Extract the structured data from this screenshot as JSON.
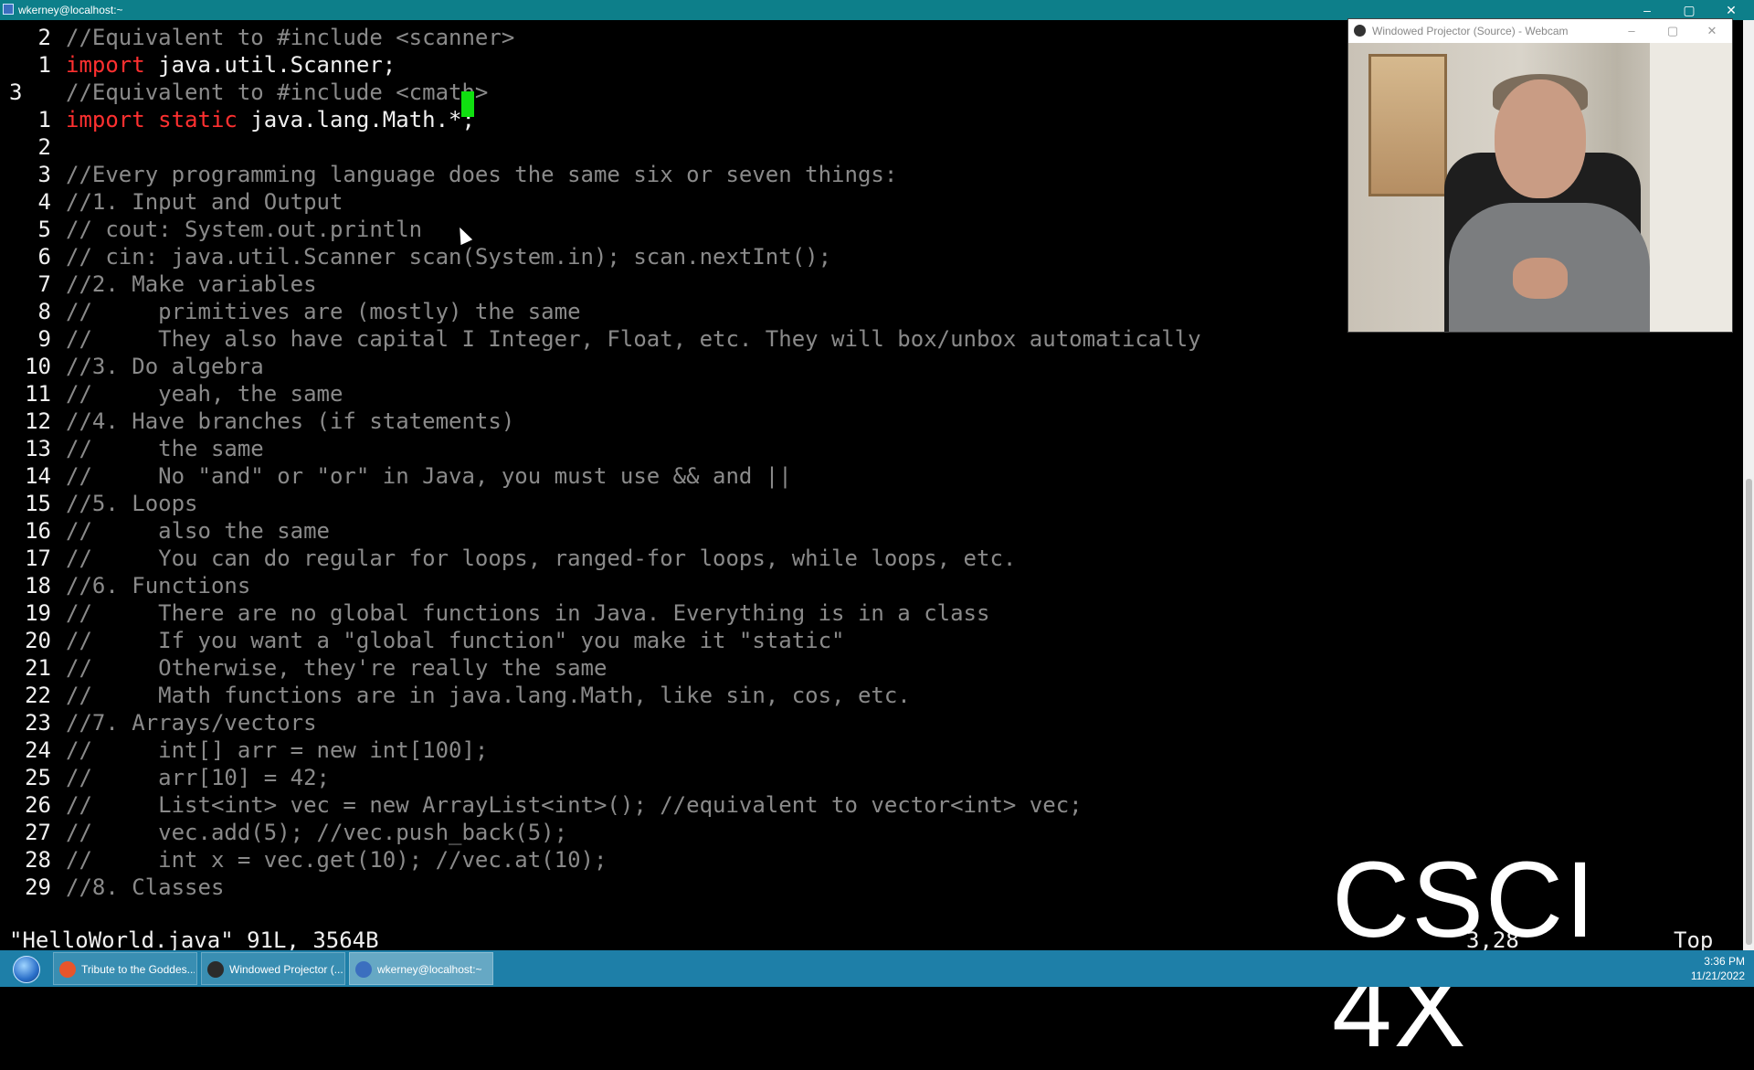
{
  "window": {
    "title": "wkerney@localhost:~",
    "controls": {
      "minimize": "–",
      "maximize": "▢",
      "close": "✕"
    }
  },
  "editor": {
    "lines": [
      {
        "num": "2",
        "parts": [
          {
            "cls": "cmt",
            "t": "//Equivalent to #include <scanner>"
          }
        ]
      },
      {
        "num": "1",
        "parts": [
          {
            "cls": "kw",
            "t": "import "
          },
          {
            "cls": "plain",
            "t": "java.util.Scanner;"
          }
        ]
      },
      {
        "num": "3",
        "current": true,
        "parts": [
          {
            "cls": "cmt",
            "t": "//Equivalent to #include <cmath>"
          }
        ]
      },
      {
        "num": "1",
        "parts": [
          {
            "cls": "kw",
            "t": "import static "
          },
          {
            "cls": "plain",
            "t": "java.lang.Math.*;"
          }
        ]
      },
      {
        "num": "2",
        "parts": [
          {
            "cls": "cmt",
            "t": ""
          }
        ]
      },
      {
        "num": "3",
        "parts": [
          {
            "cls": "cmt",
            "t": "//Every programming language does the same six or seven things:"
          }
        ]
      },
      {
        "num": "4",
        "parts": [
          {
            "cls": "cmt",
            "t": "//1. Input and Output"
          }
        ]
      },
      {
        "num": "5",
        "parts": [
          {
            "cls": "cmt",
            "t": "// cout: System.out.println"
          }
        ]
      },
      {
        "num": "6",
        "parts": [
          {
            "cls": "cmt",
            "t": "// cin: java.util.Scanner scan(System.in); scan.nextInt();"
          }
        ]
      },
      {
        "num": "7",
        "parts": [
          {
            "cls": "cmt",
            "t": "//2. Make variables"
          }
        ]
      },
      {
        "num": "8",
        "parts": [
          {
            "cls": "cmt",
            "t": "//     primitives are (mostly) the same"
          }
        ]
      },
      {
        "num": "9",
        "parts": [
          {
            "cls": "cmt",
            "t": "//     They also have capital I Integer, Float, etc. They will box/unbox automatically"
          }
        ]
      },
      {
        "num": "10",
        "parts": [
          {
            "cls": "cmt",
            "t": "//3. Do algebra"
          }
        ]
      },
      {
        "num": "11",
        "parts": [
          {
            "cls": "cmt",
            "t": "//     yeah, the same"
          }
        ]
      },
      {
        "num": "12",
        "parts": [
          {
            "cls": "cmt",
            "t": "//4. Have branches (if statements)"
          }
        ]
      },
      {
        "num": "13",
        "parts": [
          {
            "cls": "cmt",
            "t": "//     the same"
          }
        ]
      },
      {
        "num": "14",
        "parts": [
          {
            "cls": "cmt",
            "t": "//     No \"and\" or \"or\" in Java, you must use && and ||"
          }
        ]
      },
      {
        "num": "15",
        "parts": [
          {
            "cls": "cmt",
            "t": "//5. Loops"
          }
        ]
      },
      {
        "num": "16",
        "parts": [
          {
            "cls": "cmt",
            "t": "//     also the same"
          }
        ]
      },
      {
        "num": "17",
        "parts": [
          {
            "cls": "cmt",
            "t": "//     You can do regular for loops, ranged-for loops, while loops, etc."
          }
        ]
      },
      {
        "num": "18",
        "parts": [
          {
            "cls": "cmt",
            "t": "//6. Functions"
          }
        ]
      },
      {
        "num": "19",
        "parts": [
          {
            "cls": "cmt",
            "t": "//     There are no global functions in Java. Everything is in a class"
          }
        ]
      },
      {
        "num": "20",
        "parts": [
          {
            "cls": "cmt",
            "t": "//     If you want a \"global function\" you make it \"static\""
          }
        ]
      },
      {
        "num": "21",
        "parts": [
          {
            "cls": "cmt",
            "t": "//     Otherwise, they're really the same"
          }
        ]
      },
      {
        "num": "22",
        "parts": [
          {
            "cls": "cmt",
            "t": "//     Math functions are in java.lang.Math, like sin, cos, etc."
          }
        ]
      },
      {
        "num": "23",
        "parts": [
          {
            "cls": "cmt",
            "t": "//7. Arrays/vectors"
          }
        ]
      },
      {
        "num": "24",
        "parts": [
          {
            "cls": "cmt",
            "t": "//     int[] arr = new int[100];"
          }
        ]
      },
      {
        "num": "25",
        "parts": [
          {
            "cls": "cmt",
            "t": "//     arr[10] = 42;"
          }
        ]
      },
      {
        "num": "26",
        "parts": [
          {
            "cls": "cmt",
            "t": "//     List<int> vec = new ArrayList<int>(); //equivalent to vector<int> vec;"
          }
        ]
      },
      {
        "num": "27",
        "parts": [
          {
            "cls": "cmt",
            "t": "//     vec.add(5); //vec.push_back(5);"
          }
        ]
      },
      {
        "num": "28",
        "parts": [
          {
            "cls": "cmt",
            "t": "//     int x = vec.get(10); //vec.at(10);"
          }
        ]
      },
      {
        "num": "29",
        "parts": [
          {
            "cls": "cmt",
            "t": "//8. Classes"
          }
        ]
      }
    ],
    "status_file": "\"HelloWorld.java\" 91L, 3564B",
    "status_pos": "3,28",
    "status_top": "Top"
  },
  "overlay": {
    "watermark": "CSCI 4X"
  },
  "webcam": {
    "title": "Windowed Projector (Source) - Webcam",
    "controls": {
      "minimize": "–",
      "maximize": "▢",
      "close": "✕"
    }
  },
  "taskbar": {
    "tasks": [
      {
        "label": "Tribute to the Goddes...",
        "icon_color": "#e8552b"
      },
      {
        "label": "Windowed Projector (...",
        "icon_color": "#2b2b2b"
      },
      {
        "label": "wkerney@localhost:~",
        "icon_color": "#3b6fbf",
        "active": true
      }
    ],
    "time": "3:36 PM",
    "date": "11/21/2022"
  }
}
